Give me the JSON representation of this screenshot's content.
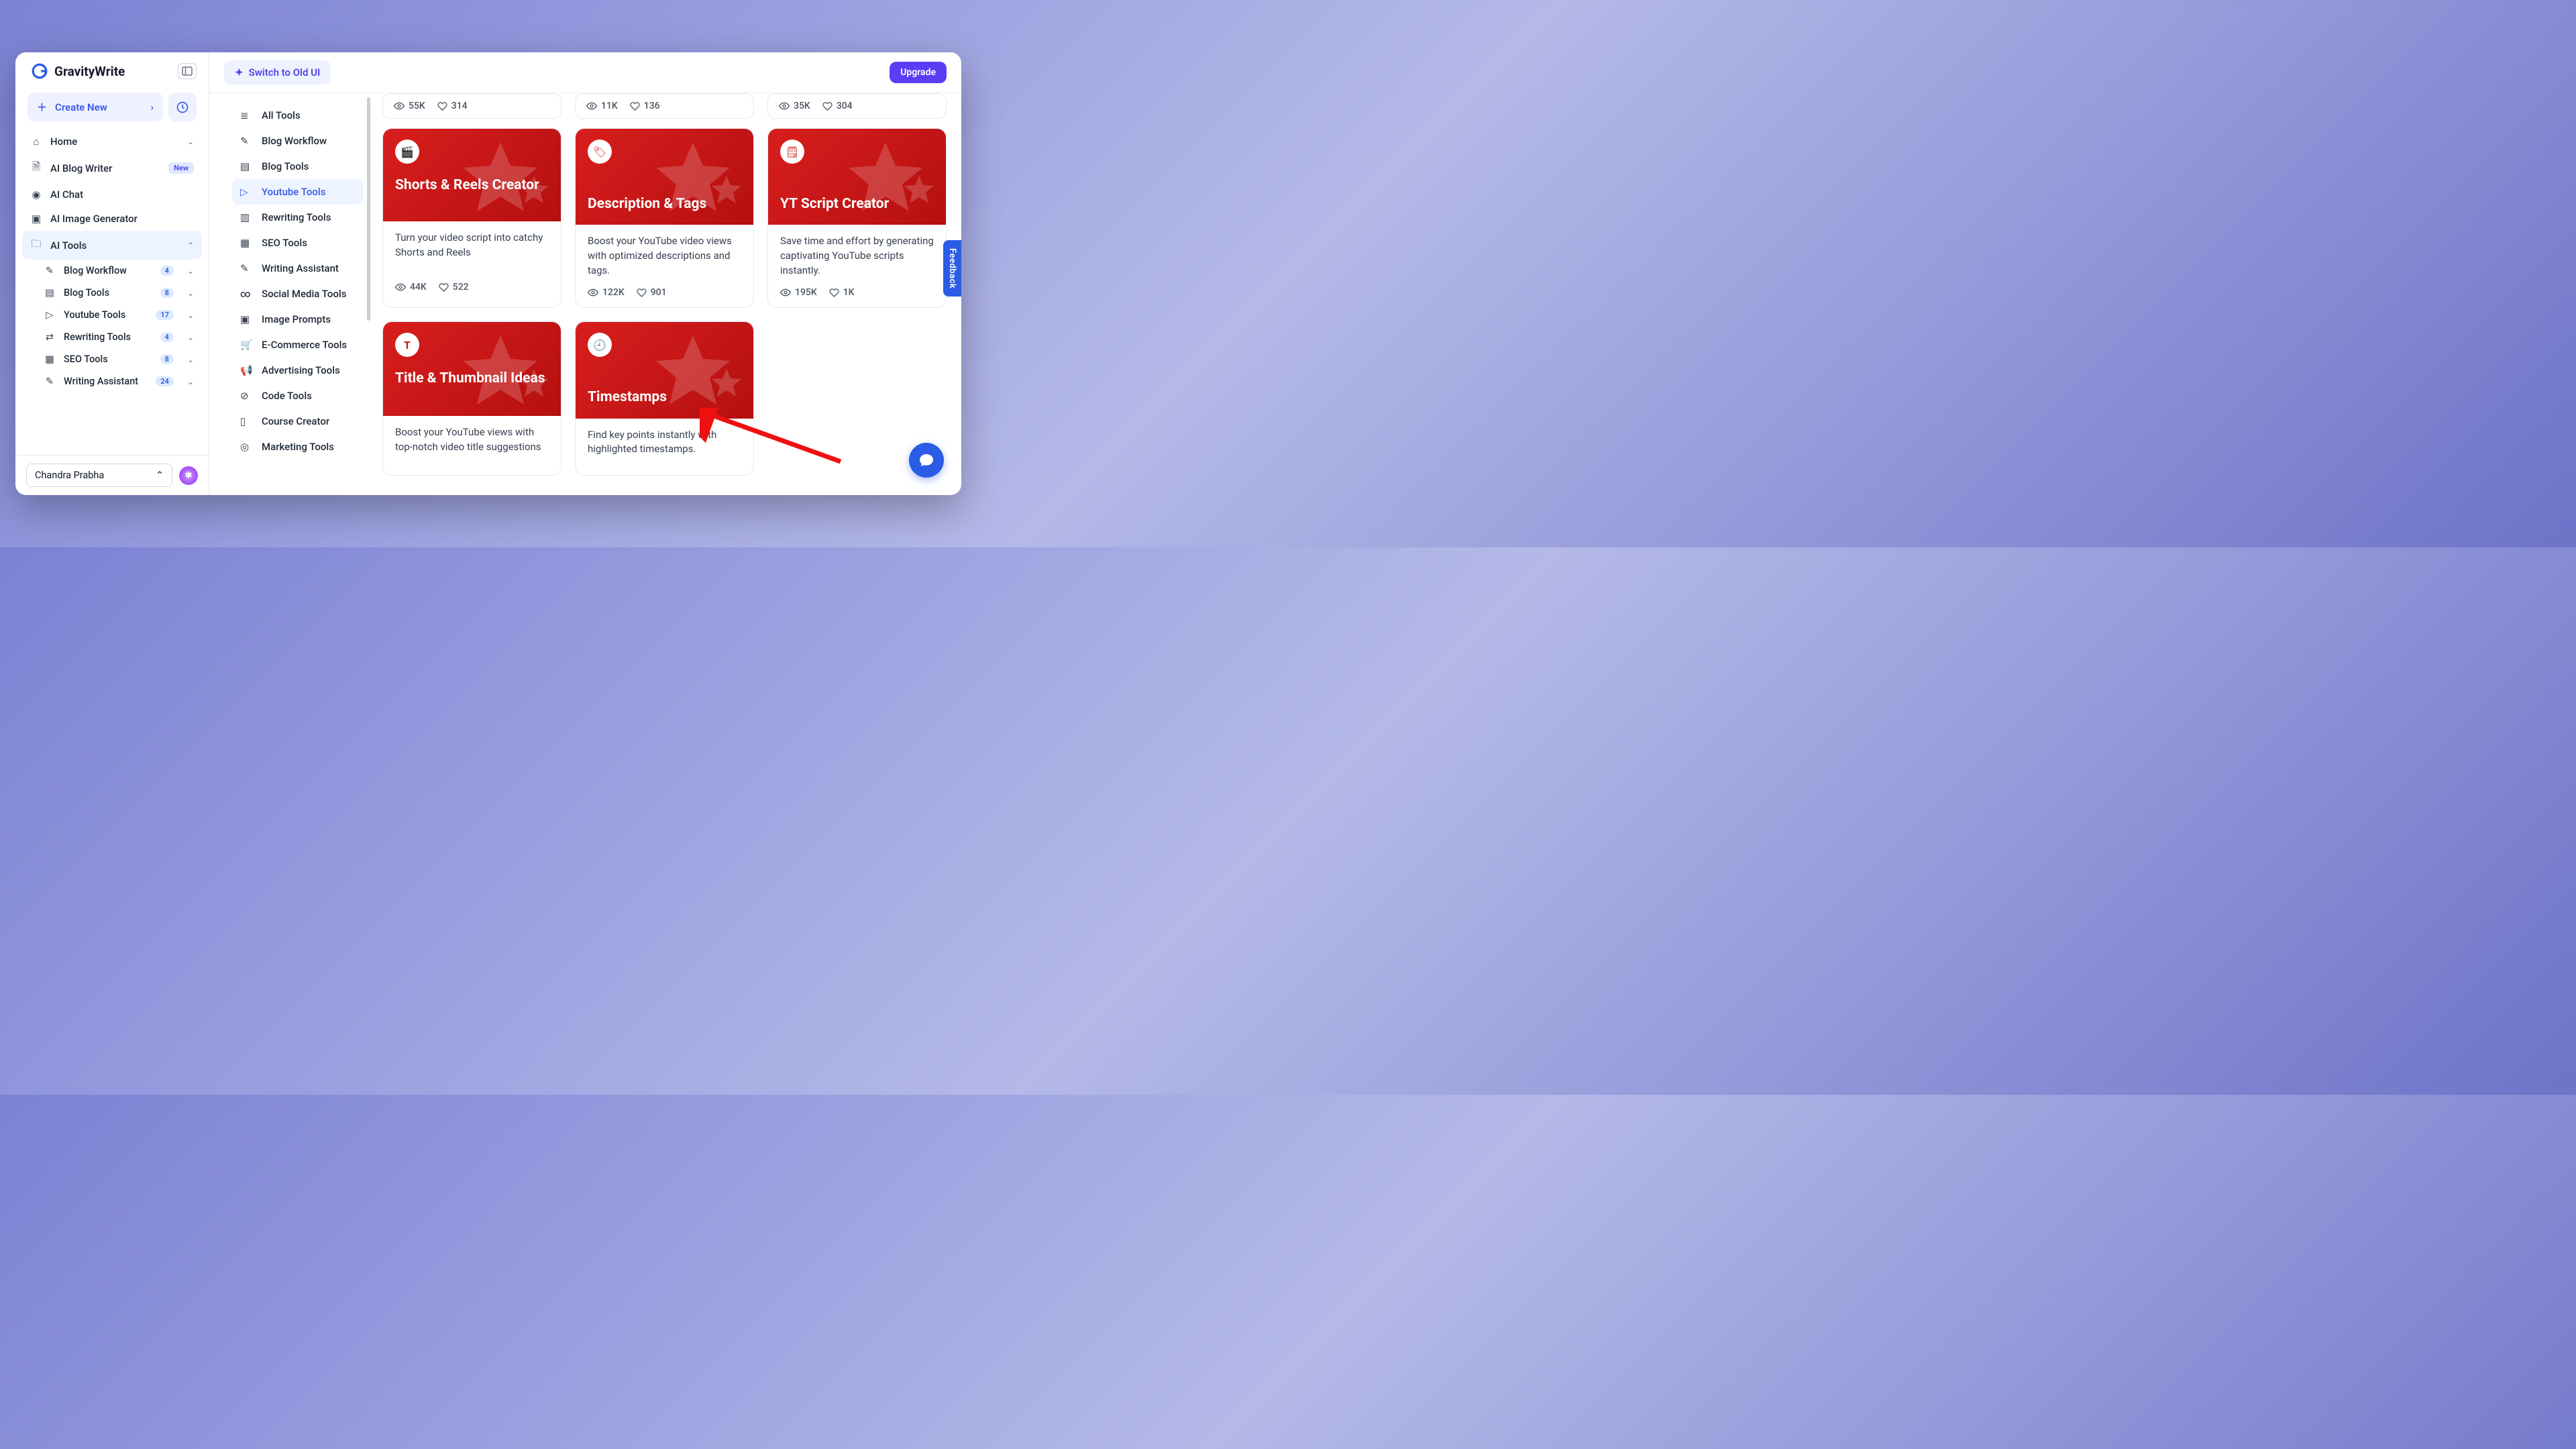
{
  "brand": {
    "name": "GravityWrite"
  },
  "sidebar": {
    "create_label": "Create New",
    "nav": {
      "home": "Home",
      "blog_writer": "AI Blog Writer",
      "blog_writer_badge": "New",
      "ai_chat": "AI Chat",
      "ai_image": "AI Image Generator",
      "ai_tools": "AI Tools"
    },
    "sub": [
      {
        "label": "Blog Workflow",
        "count": "4"
      },
      {
        "label": "Blog Tools",
        "count": "8"
      },
      {
        "label": "Youtube Tools",
        "count": "17"
      },
      {
        "label": "Rewriting Tools",
        "count": "4"
      },
      {
        "label": "SEO Tools",
        "count": "8"
      },
      {
        "label": "Writing Assistant",
        "count": "24"
      }
    ],
    "user": "Chandra Prabha"
  },
  "topbar": {
    "switch_label": "Switch to Old UI",
    "upgrade_label": "Upgrade"
  },
  "categories": [
    "All Tools",
    "Blog Workflow",
    "Blog Tools",
    "Youtube Tools",
    "Rewriting Tools",
    "SEO Tools",
    "Writing Assistant",
    "Social Media Tools",
    "Image Prompts",
    "E-Commerce Tools",
    "Advertising Tools",
    "Code Tools",
    "Course Creator",
    "Marketing Tools"
  ],
  "category_selected_index": 3,
  "top_stats": [
    {
      "views": "55K",
      "likes": "314"
    },
    {
      "views": "11K",
      "likes": "136"
    },
    {
      "views": "35K",
      "likes": "304"
    }
  ],
  "cards": [
    {
      "title": "Shorts & Reels Creator",
      "desc": "Turn your video script into catchy Shorts and Reels",
      "views": "44K",
      "likes": "522",
      "icon": "video"
    },
    {
      "title": "Description & Tags",
      "desc": "Boost your YouTube video views with optimized descriptions and tags.",
      "views": "122K",
      "likes": "901",
      "icon": "tag"
    },
    {
      "title": "YT Script Creator",
      "desc": "Save time and effort by generating captivating YouTube scripts instantly.",
      "views": "195K",
      "likes": "1K",
      "icon": "script"
    },
    {
      "title": "Title & Thumbnail Ideas",
      "desc": "Boost your YouTube views with top-notch video title suggestions",
      "icon": "text"
    },
    {
      "title": "Timestamps",
      "desc": "Find key points instantly with highlighted timestamps.",
      "icon": "clock"
    }
  ],
  "feedback_label": "Feedback"
}
